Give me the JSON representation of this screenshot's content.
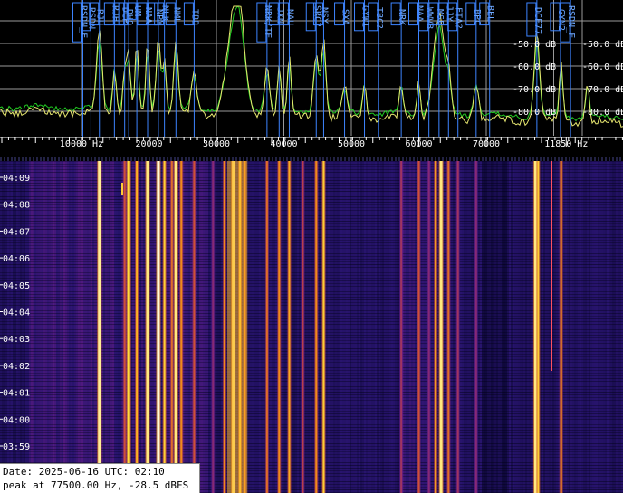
{
  "spectrum": {
    "db_labels": [
      "-50.0 dB",
      "-60.0 dB",
      "-70.0 dB",
      "-80.0 dB"
    ],
    "db_labels_right": [
      "-50.0 dB",
      "-60.0 dB",
      "-70.0 dB",
      "-80.0 dB"
    ],
    "markers": [
      {
        "label": "RSDN_F",
        "freq": 10200
      },
      {
        "label": "RSDN",
        "freq": 11400
      },
      {
        "label": "RJH",
        "freq": 12650
      },
      {
        "label": "RJH",
        "freq": 14880
      },
      {
        "label": "DCF",
        "freq": 16400
      },
      {
        "label": "DHO",
        "freq": 17000
      },
      {
        "label": "UM",
        "freq": 18200
      },
      {
        "label": "NAA",
        "freq": 19800
      },
      {
        "label": "NPM",
        "freq": 21400
      },
      {
        "label": "NLK",
        "freq": 22300
      },
      {
        "label": "NML",
        "freq": 24000
      },
      {
        "label": "TBB",
        "freq": 26700
      },
      {
        "label": "NRK/TF",
        "freq": 37500
      },
      {
        "label": "JXN",
        "freq": 39300
      },
      {
        "label": "NAU",
        "freq": 40800
      },
      {
        "label": "SRC?",
        "freq": 44800
      },
      {
        "label": "NSY",
        "freq": 45900
      },
      {
        "label": "SXA",
        "freq": 49000
      },
      {
        "label": "GYW1",
        "freq": 51950
      },
      {
        "label": "TBC?",
        "freq": 54000
      },
      {
        "label": "NRK",
        "freq": 57400
      },
      {
        "label": "NAA",
        "freq": 60000
      },
      {
        "label": "WWVB",
        "freq": 61500
      },
      {
        "label": "MSF",
        "freq": 63000
      },
      {
        "label": "JJY",
        "freq": 64400
      },
      {
        "label": "FTA?",
        "freq": 65800
      },
      {
        "label": "BPC",
        "freq": 68500
      },
      {
        "label": "BEL",
        "freq": 70500
      },
      {
        "label": "DCF77",
        "freq": 77500
      },
      {
        "label": "GYN2",
        "freq": 81000
      },
      {
        "label": "RSDN_F",
        "freq": 82500
      }
    ],
    "freq_labels": [
      {
        "freq": 10000,
        "text": "10000 Hz"
      },
      {
        "freq": 20000,
        "text": "20000"
      },
      {
        "freq": 30000,
        "text": "30000"
      },
      {
        "freq": 40000,
        "text": "40000"
      },
      {
        "freq": 50000,
        "text": "50000"
      },
      {
        "freq": 60000,
        "text": "60000"
      },
      {
        "freq": 70000,
        "text": "70000"
      },
      {
        "freq": 81850,
        "text": "11850 Hz"
      }
    ],
    "colors": {
      "grid": "#9a9a9a",
      "marker_line": "#3d84ff",
      "marker_text": "#6ea8ff",
      "trace_peak": "#22cc22",
      "trace_current": "#e8e870",
      "db_text": "#ffffff",
      "tick": "#ffffff"
    }
  },
  "waterfall": {
    "time_labels": [
      "04:09",
      "04:08",
      "04:07",
      "04:06",
      "04:05",
      "04:04",
      "04:03",
      "04:02",
      "04:01",
      "04:00",
      "03:59"
    ],
    "carriers": [
      {
        "freq": 12650,
        "level": 0.96
      },
      {
        "freq": 16400,
        "level": 0.7
      },
      {
        "freq": 17000,
        "level": 0.92
      },
      {
        "freq": 18200,
        "level": 0.86
      },
      {
        "freq": 19800,
        "level": 0.95
      },
      {
        "freq": 21400,
        "level": 0.99
      },
      {
        "freq": 22300,
        "level": 0.9
      },
      {
        "freq": 23400,
        "level": 0.75
      },
      {
        "freq": 24000,
        "level": 0.95
      },
      {
        "freq": 24800,
        "level": 0.8
      },
      {
        "freq": 26700,
        "level": 0.7
      },
      {
        "freq": 29500,
        "level": 0.55
      },
      {
        "freq": 31200,
        "level": 0.8
      },
      {
        "freq": 32500,
        "level": 0.95
      },
      {
        "freq": 33500,
        "level": 0.9
      },
      {
        "freq": 34200,
        "level": 0.8
      },
      {
        "freq": 37500,
        "level": 0.75
      },
      {
        "freq": 39300,
        "level": 0.8
      },
      {
        "freq": 40800,
        "level": 0.85
      },
      {
        "freq": 42800,
        "level": 0.65
      },
      {
        "freq": 44800,
        "level": 0.8
      },
      {
        "freq": 45900,
        "level": 0.9
      },
      {
        "freq": 57400,
        "level": 0.6
      },
      {
        "freq": 60000,
        "level": 0.7
      },
      {
        "freq": 61500,
        "level": 0.55
      },
      {
        "freq": 62500,
        "level": 0.85
      },
      {
        "freq": 63300,
        "level": 0.95
      },
      {
        "freq": 64400,
        "level": 0.75
      },
      {
        "freq": 65800,
        "level": 0.6
      },
      {
        "freq": 68500,
        "level": 0.55
      },
      {
        "freq": 77300,
        "level": 0.95
      },
      {
        "freq": 77700,
        "level": 0.9
      },
      {
        "freq": 81100,
        "level": 0.8
      }
    ],
    "colors": {
      "background": "#06042a",
      "time_text": "#ffffff"
    }
  },
  "info": {
    "date_line": "Date: 2025-06-16 UTC: 02:10",
    "peak_line": "peak at 77500.00 Hz, -28.5 dBFS"
  }
}
